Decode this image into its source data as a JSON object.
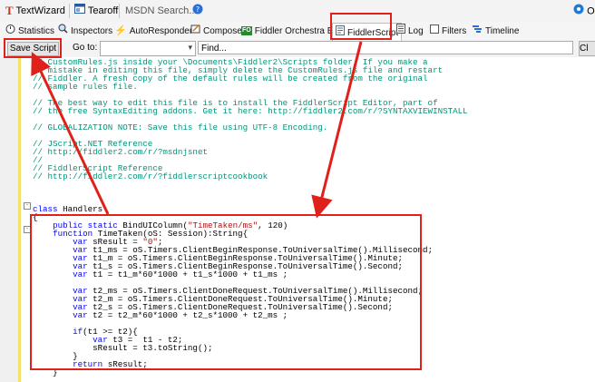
{
  "toolbar": {
    "textwizard_label": "TextWizard",
    "tearoff_label": "Tearoff",
    "search_text": "MSDN Search...",
    "right_label": "O"
  },
  "tabs": [
    {
      "label": "Statistics",
      "icon": "stopwatch-icon"
    },
    {
      "label": "Inspectors",
      "icon": "magnifier-icon"
    },
    {
      "label": "AutoResponder",
      "icon": "lightning-icon"
    },
    {
      "label": "Composer",
      "icon": "pencil-icon"
    },
    {
      "label": "Fiddler Orchestra Beta",
      "icon": "fo-icon",
      "badge": "FO"
    },
    {
      "label": "FiddlerScript",
      "icon": "script-icon",
      "active": true
    },
    {
      "label": "Log",
      "icon": "document-icon"
    },
    {
      "label": "Filters",
      "icon": "checkbox-icon"
    },
    {
      "label": "Timeline",
      "icon": "timeline-icon"
    }
  ],
  "scriptbar": {
    "save_label": "Save Script",
    "goto_label": "Go to:",
    "find_placeholder": "Find...",
    "clear_label": "Cl"
  },
  "code_lines": [
    {
      "text": "// CustomRules.js inside your \\Documents\\Fiddler2\\Scripts folder. If you make a",
      "cls": "cm"
    },
    {
      "text": "// mistake in editing this file, simply delete the CustomRules.js file and restart",
      "cls": "cm"
    },
    {
      "text": "// Fiddler. A fresh copy of the default rules will be created from the original",
      "cls": "cm"
    },
    {
      "text": "// sample rules file.",
      "cls": "cm"
    },
    {
      "text": "",
      "cls": ""
    },
    {
      "text": "// The best way to edit this file is to install the FiddlerScript Editor, part of",
      "cls": "cm"
    },
    {
      "text": "// the free SyntaxEditing addons. Get it here: http://fiddler2.com/r/?SYNTAXVIEWINSTALL",
      "cls": "cm"
    },
    {
      "text": "",
      "cls": ""
    },
    {
      "text": "// GLOBALIZATION NOTE: Save this file using UTF-8 Encoding.",
      "cls": "cm"
    },
    {
      "text": "",
      "cls": ""
    },
    {
      "text": "// JScript.NET Reference",
      "cls": "cm"
    },
    {
      "text": "// http://fiddler2.com/r/?msdnjsnet",
      "cls": "cm"
    },
    {
      "text": "//",
      "cls": "cm"
    },
    {
      "text": "// FiddlerScript Reference",
      "cls": "cm"
    },
    {
      "text": "// http://fiddler2.com/r/?fiddlerscriptcookbook",
      "cls": "cm"
    },
    {
      "text": "",
      "cls": ""
    },
    {
      "text": "",
      "cls": ""
    },
    {
      "text": "",
      "cls": ""
    },
    {
      "text": "class Handlers",
      "cls": "kwline"
    },
    {
      "text": "{",
      "cls": ""
    },
    {
      "text": "    public static BindUIColumn(\"TimeTaken/ms\", 120)",
      "cls": "attr"
    },
    {
      "text": "    function TimeTaken(oS: Session):String{",
      "cls": "fn"
    },
    {
      "text": "        var sResult = \"0\";",
      "cls": "var"
    },
    {
      "text": "        var t1_ms = oS.Timers.ClientBeginResponse.ToUniversalTime().Millisecond;",
      "cls": "var"
    },
    {
      "text": "        var t1_m = oS.Timers.ClientBeginResponse.ToUniversalTime().Minute;",
      "cls": "var"
    },
    {
      "text": "        var t1_s = oS.Timers.ClientBeginResponse.ToUniversalTime().Second;",
      "cls": "var"
    },
    {
      "text": "        var t1 = t1_m*60*1000 + t1_s*1000 + t1_ms ;",
      "cls": "var"
    },
    {
      "text": "",
      "cls": ""
    },
    {
      "text": "        var t2_ms = oS.Timers.ClientDoneRequest.ToUniversalTime().Millisecond;",
      "cls": "var"
    },
    {
      "text": "        var t2_m = oS.Timers.ClientDoneRequest.ToUniversalTime().Minute;",
      "cls": "var"
    },
    {
      "text": "        var t2_s = oS.Timers.ClientDoneRequest.ToUniversalTime().Second;",
      "cls": "var"
    },
    {
      "text": "        var t2 = t2_m*60*1000 + t2_s*1000 + t2_ms ;",
      "cls": "var"
    },
    {
      "text": "",
      "cls": ""
    },
    {
      "text": "        if(t1 >= t2){",
      "cls": "if"
    },
    {
      "text": "            var t3 =  t1 - t2;",
      "cls": "var"
    },
    {
      "text": "            sResult = t3.toString();",
      "cls": ""
    },
    {
      "text": "        }",
      "cls": ""
    },
    {
      "text": "        return sResult;",
      "cls": "ret"
    },
    {
      "text": "    }",
      "cls": ""
    },
    {
      "text": "",
      "cls": ""
    },
    {
      "text": "    // ****************",
      "cls": "cm"
    }
  ],
  "colors": {
    "annotation_red": "#e0201a",
    "comment_green": "#00957a",
    "keyword_blue": "#0000ff",
    "string_red": "#a31515",
    "active_line_yellow": "#f4e06c"
  }
}
